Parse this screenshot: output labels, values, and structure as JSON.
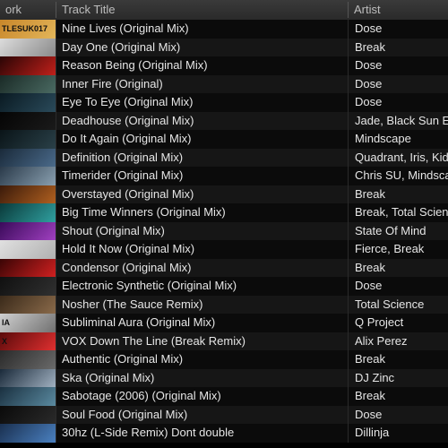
{
  "header": {
    "artwork": "ork",
    "title": "Track Title",
    "artist": "Artist"
  },
  "rows": [
    {
      "title": "Nine Lives (Original Mix)",
      "artist": "Dose",
      "art": [
        "#c8862a",
        "#e3b65a"
      ],
      "art_text": "TLESUK017"
    },
    {
      "title": "Day One (Original Mix)",
      "artist": "Break",
      "art": [
        "#dcdcdc",
        "#8a8a8a"
      ],
      "art_text": ""
    },
    {
      "title": "Reason Being (Original Mix)",
      "artist": "Dose",
      "art": [
        "#2a0505",
        "#c0201a"
      ],
      "art_text": ""
    },
    {
      "title": "Inner Fire (Original)",
      "artist": "Dose",
      "art": [
        "#1a2a26",
        "#4a6a62"
      ],
      "art_text": ""
    },
    {
      "title": "Eye To Eye (Original Mix)",
      "artist": "Dose",
      "art": [
        "#0a1a22",
        "#2a4a5a"
      ],
      "art_text": ""
    },
    {
      "title": "Deadhouse (Original Mix)",
      "artist": "Jade, Black Sun Em",
      "art": [
        "#050505",
        "#1a1a1a"
      ],
      "art_text": ""
    },
    {
      "title": "Do It Again (Original Mix)",
      "artist": "Mindscape",
      "art": [
        "#0a1418",
        "#2a4048"
      ],
      "art_text": ""
    },
    {
      "title": "Definition (Original Mix)",
      "artist": "Quadrant, Iris, Kid I",
      "art": [
        "#1a2a3a",
        "#4a6a8a"
      ],
      "art_text": ""
    },
    {
      "title": "Timerider (Original Mix)",
      "artist": "Chris SU, Mindscap",
      "art": [
        "#2a3a4a",
        "#8aa0b0"
      ],
      "art_text": ""
    },
    {
      "title": "Overstayed (Original Mix)",
      "artist": "Break",
      "art": [
        "#3a1a0a",
        "#b06020"
      ],
      "art_text": ""
    },
    {
      "title": "Big Time Winners (Original Mix)",
      "artist": "Break, Total Scienc",
      "art": [
        "#0a3a3a",
        "#30a0a0"
      ],
      "art_text": ""
    },
    {
      "title": "Shout (Original Mix)",
      "artist": "State Of Mind",
      "art": [
        "#3a0a5a",
        "#a040c0"
      ],
      "art_text": ""
    },
    {
      "title": "Hold It Now (Original Mix)",
      "artist": "Fierce, Break",
      "art": [
        "#e0e0e0",
        "#b0b0b0"
      ],
      "art_text": ""
    },
    {
      "title": "Condensor (Original Mix)",
      "artist": "Break",
      "art": [
        "#3a0505",
        "#d02020"
      ],
      "art_text": ""
    },
    {
      "title": "Electronic Synthetic (Original Mix)",
      "artist": "Dose",
      "art": [
        "#101010",
        "#303030"
      ],
      "art_text": ""
    },
    {
      "title": "Nosher (The Sauce Remix)",
      "artist": "Total Science",
      "art": [
        "#3a2a1a",
        "#8a6a4a"
      ],
      "art_text": ""
    },
    {
      "title": "Subliminal Aura (Original Mix)",
      "artist": "Q Project",
      "art": [
        "#d0d0d0",
        "#707070"
      ],
      "art_text": "IA"
    },
    {
      "title": "VOX Down The Line (Break Remix)",
      "artist": "Alix Perez",
      "art": [
        "#5a0a0a",
        "#e03030"
      ],
      "art_text": "X"
    },
    {
      "title": "Authentic (Original Mix)",
      "artist": "Break",
      "art": [
        "#2a2a2a",
        "#6a6a6a"
      ],
      "art_text": ""
    },
    {
      "title": "Ska (Original Mix)",
      "artist": "DJ Zinc",
      "art": [
        "#1a2a3a",
        "#a0b0c0"
      ],
      "art_text": ""
    },
    {
      "title": "Sabotage (2006) (Original Mix)",
      "artist": "Break",
      "art": [
        "#1a3040",
        "#5a8aa0"
      ],
      "art_text": ""
    },
    {
      "title": "Soul Food (Original Mix)",
      "artist": "Dose",
      "art": [
        "#0a0a0a",
        "#2a2a2a"
      ],
      "art_text": ""
    },
    {
      "title": "30hz (L-Side Remix) Dont double",
      "artist": "Dillinja",
      "art": [
        "#1a3050",
        "#4a80c0"
      ],
      "art_text": ""
    }
  ]
}
